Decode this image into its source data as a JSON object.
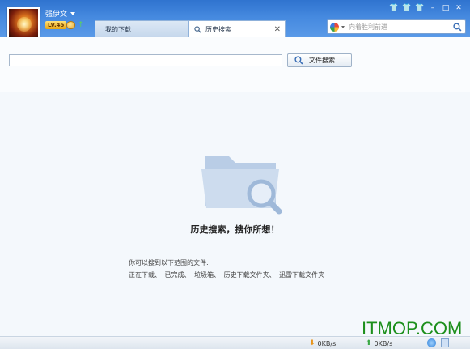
{
  "user": {
    "name": "强伊文",
    "level": "LV.45"
  },
  "tabs": [
    {
      "label": "我的下载"
    },
    {
      "label": "历史搜索",
      "close": "✕"
    }
  ],
  "window_controls": {
    "minimize": "–",
    "maximize": "□",
    "close": "✕"
  },
  "web_search": {
    "placeholder": "向着胜利前进"
  },
  "file_search": {
    "input_value": "",
    "button_label": "文件搜索"
  },
  "empty_state": {
    "title": "历史搜索，搜你所想！",
    "hint_intro": "你可以搜到以下范围的文件:",
    "hint_scopes": "正在下载、 已完成、 垃圾箱、 历史下载文件夹、 迅雷下载文件夹"
  },
  "status": {
    "download_speed": "0KB/s",
    "upload_speed": "0KB/s"
  },
  "watermark": "ITMOP.COM",
  "colors": {
    "header": "#4589df",
    "accent": "#2f73cf",
    "download_arrow": "#e8951c",
    "upload_arrow": "#3aa845",
    "watermark": "#1c8f1c"
  }
}
